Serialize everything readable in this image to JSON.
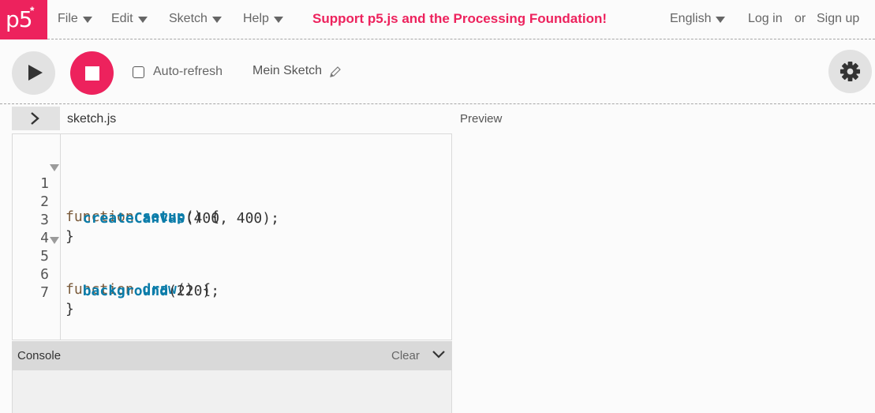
{
  "logo": {
    "text": "p5",
    "star": "*"
  },
  "menu": {
    "file": "File",
    "edit": "Edit",
    "sketch": "Sketch",
    "help": "Help"
  },
  "banner": "Support p5.js and the Processing Foundation!",
  "account": {
    "language": "English",
    "login": "Log in",
    "or": "or",
    "signup": "Sign up"
  },
  "toolbar": {
    "auto_refresh_label": "Auto-refresh",
    "auto_refresh_checked": false,
    "sketch_name": "Mein Sketch"
  },
  "editor": {
    "filename": "sketch.js",
    "preview_label": "Preview",
    "lines": [
      {
        "num": "1",
        "fold": true
      },
      {
        "num": "2",
        "fold": false
      },
      {
        "num": "3",
        "fold": false
      },
      {
        "num": "4",
        "fold": false
      },
      {
        "num": "5",
        "fold": true
      },
      {
        "num": "6",
        "fold": false
      },
      {
        "num": "7",
        "fold": false
      }
    ],
    "code": {
      "l1_kw": "function",
      "l1_fn": "setup",
      "l1_rest": "() {",
      "l2_fn": "createCanvas",
      "l2_rest": "(400, 400);",
      "l3": "}",
      "l5_kw": "function",
      "l5_fn": "draw",
      "l5_rest": "() {",
      "l6_fn": "background",
      "l6_rest": "(220);",
      "l7": "}"
    }
  },
  "console": {
    "title": "Console",
    "clear": "Clear"
  },
  "colors": {
    "accent": "#ed225d",
    "keyword": "#7a5a3a",
    "function": "#0b7ca9"
  },
  "icons": [
    "play-icon",
    "stop-icon",
    "pencil-icon",
    "gear-icon",
    "chevron-right-icon",
    "chevron-down-icon",
    "caret-down-icon"
  ]
}
